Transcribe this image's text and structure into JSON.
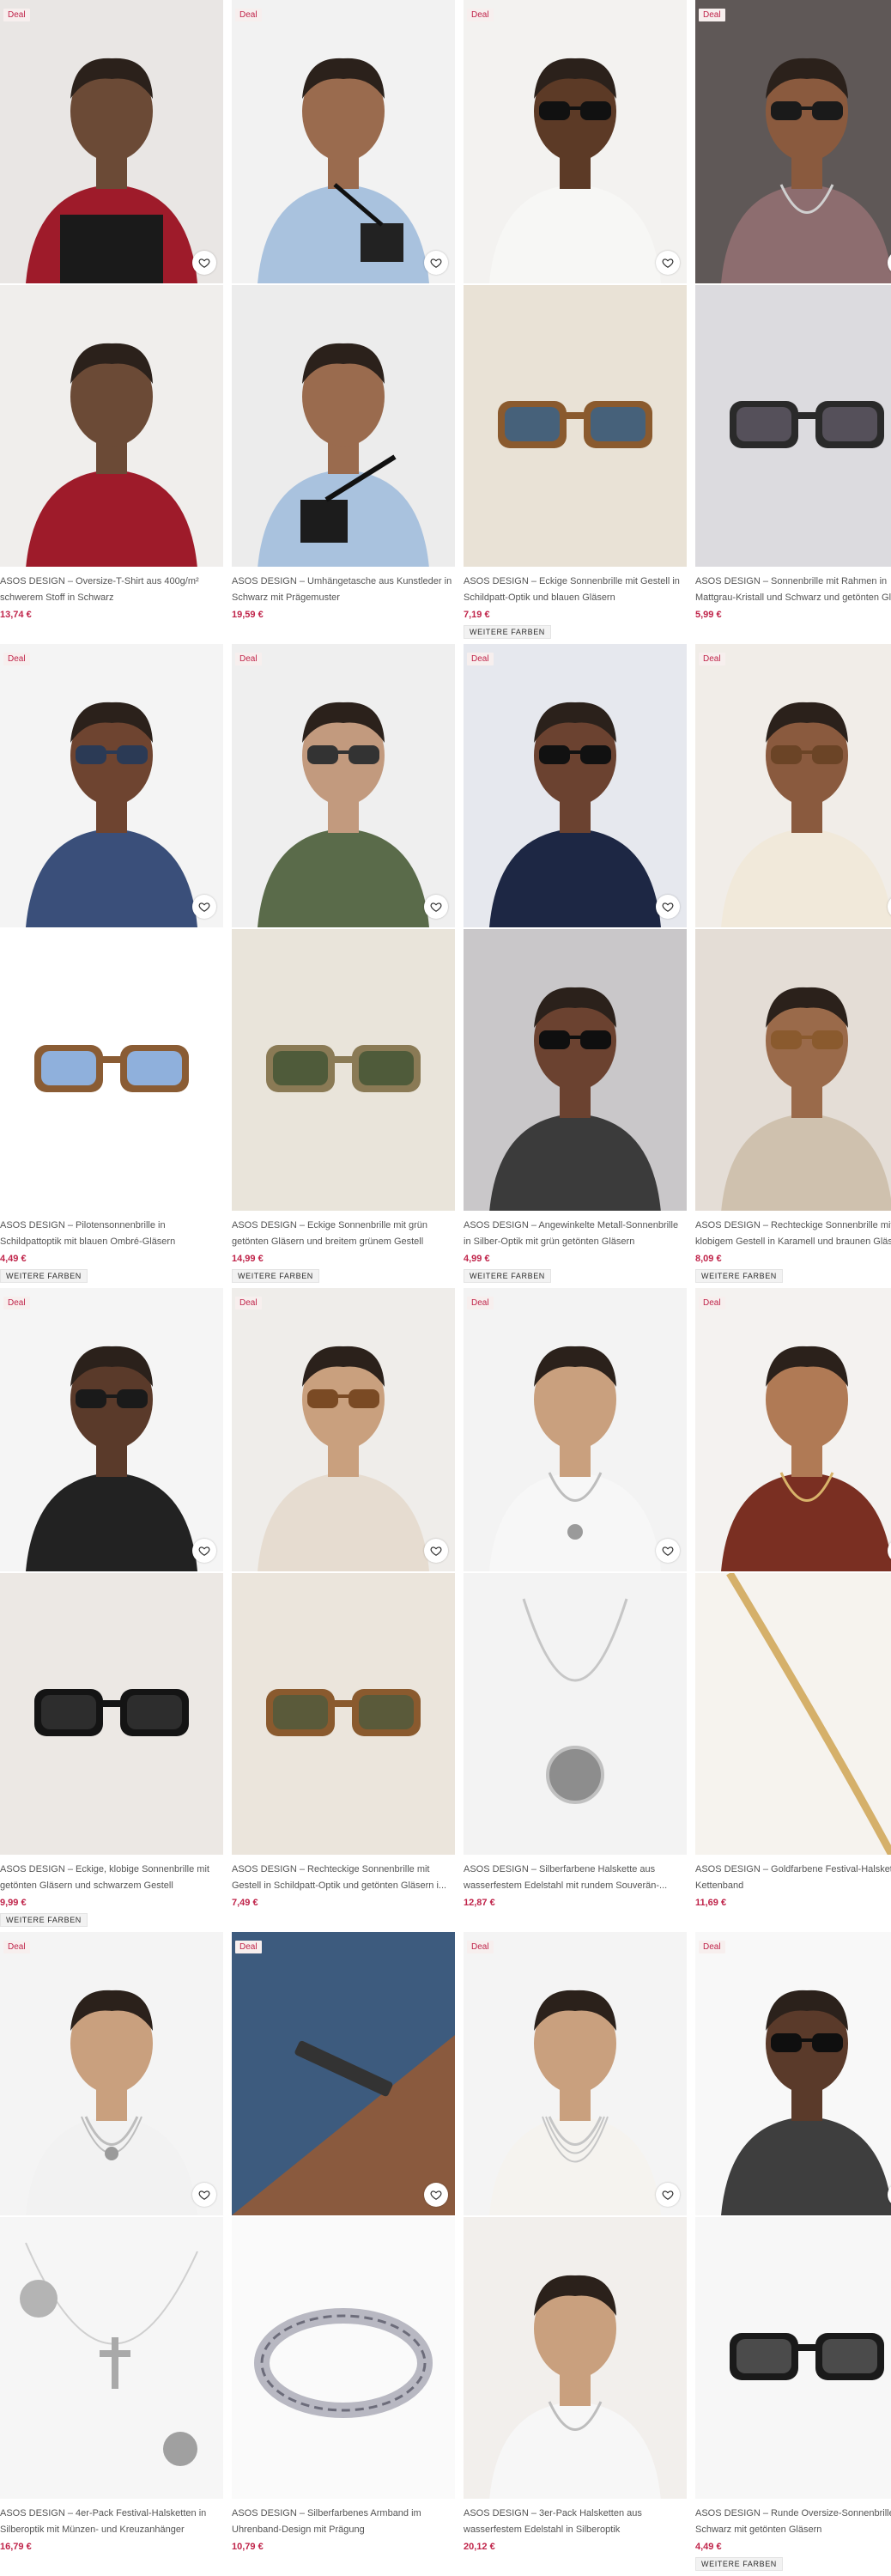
{
  "deal_label": "Deal",
  "more_colors_label": "WEITERE FARBEN",
  "products": [
    {
      "title": "ASOS DESIGN – Oversize-T-Shirt aus 400g/m² schwerem Stoff in Schwarz",
      "price": "13,74 €",
      "deal": true,
      "more_colors": false,
      "top": "person-red-sweater",
      "bottom": "person-red-sweater-full"
    },
    {
      "title": "ASOS DESIGN – Umhängetasche aus Kunstleder in Schwarz mit Prägemuster",
      "price": "19,59 €",
      "deal": true,
      "more_colors": false,
      "top": "person-blue-shirt-bag",
      "bottom": "bag-back-view"
    },
    {
      "title": "ASOS DESIGN – Eckige Sonnenbrille mit Gestell in Schildpatt-Optik und blauen Gläsern",
      "price": "7,19 €",
      "deal": true,
      "more_colors": true,
      "top": "person-white-shirt-sunglasses",
      "bottom": "tortoise-sunglasses"
    },
    {
      "title": "ASOS DESIGN – Sonnenbrille mit Rahmen in Mattgrau-Kristall und Schwarz und getönten Gläsern",
      "price": "5,99 €",
      "deal": true,
      "more_colors": false,
      "top": "person-braids-sunglasses",
      "bottom": "grey-sunglasses"
    },
    {
      "title": "ASOS DESIGN – Pilotensonnenbrille in Schildpattoptik mit blauen Ombré-Gläsern",
      "price": "4,49 €",
      "deal": true,
      "more_colors": true,
      "top": "person-sunglasses-blue-top",
      "bottom": "pilot-sunglasses"
    },
    {
      "title": "ASOS DESIGN – Eckige Sonnenbrille mit grün getönten Gläsern und breitem grünem Gestell",
      "price": "14,99 €",
      "deal": true,
      "more_colors": true,
      "top": "person-green-shirt-sunglasses",
      "bottom": "green-sunglasses"
    },
    {
      "title": "ASOS DESIGN – Angewinkelte Metall-Sonnenbrille in Silber-Optik mit grün getönten Gläsern",
      "price": "4,99 €",
      "deal": true,
      "more_colors": true,
      "top": "person-navy-shirt-sunglasses",
      "bottom": "face-metal-sunglasses"
    },
    {
      "title": "ASOS DESIGN – Rechteckige Sonnenbrille mit klobigem Gestell in Karamell und braunen Gläsern",
      "price": "8,09 €",
      "deal": true,
      "more_colors": true,
      "top": "person-cream-shirt-sunglasses",
      "bottom": "face-caramel-sunglasses"
    },
    {
      "title": "ASOS DESIGN – Eckige, klobige Sonnenbrille mit getönten Gläsern und schwarzem Gestell",
      "price": "9,99 €",
      "deal": true,
      "more_colors": true,
      "top": "person-striped-sunglasses",
      "bottom": "black-chunky-sunglasses"
    },
    {
      "title": "ASOS DESIGN – Rechteckige Sonnenbrille mit Gestell in Schildpatt-Optik und getönten Gläsern i...",
      "price": "7,49 €",
      "deal": true,
      "more_colors": false,
      "top": "person-tortoise-sunglasses",
      "bottom": "tortoise-rect-sunglasses"
    },
    {
      "title": "ASOS DESIGN – Silberfarbene Halskette aus wasserfestem Edelstahl mit rundem Souverän-...",
      "price": "12,87 €",
      "deal": true,
      "more_colors": false,
      "top": "person-pendant-necklace",
      "bottom": "coin-pendant"
    },
    {
      "title": "ASOS DESIGN – Goldfarbene Festival-Halskette Kettenband",
      "price": "11,69 €",
      "deal": true,
      "more_colors": false,
      "top": "person-gold-chain",
      "bottom": "gold-chain"
    },
    {
      "title": "ASOS DESIGN – 4er-Pack Festival-Halsketten in Silberoptik mit Münzen- und Kreuzanhänger",
      "price": "16,79 €",
      "deal": true,
      "more_colors": false,
      "top": "person-layered-necklaces",
      "bottom": "cross-coin-necklaces"
    },
    {
      "title": "ASOS DESIGN – Silberfarbenes Armband im Uhrenband-Design mit Prägung",
      "price": "10,79 €",
      "deal": true,
      "more_colors": false,
      "top": "wrist-bracelet",
      "bottom": "silver-bracelet"
    },
    {
      "title": "ASOS DESIGN – 3er-Pack Halsketten aus wasserfestem Edelstahl in Silberoptik",
      "price": "20,12 €",
      "deal": true,
      "more_colors": false,
      "top": "person-three-chains",
      "bottom": "neck-chains"
    },
    {
      "title": "ASOS DESIGN – Runde Oversize-Sonnenbrille in Schwarz mit getönten Gläsern",
      "price": "4,49 €",
      "deal": true,
      "more_colors": true,
      "top": "person-round-sunglasses",
      "bottom": "round-black-sunglasses"
    }
  ]
}
